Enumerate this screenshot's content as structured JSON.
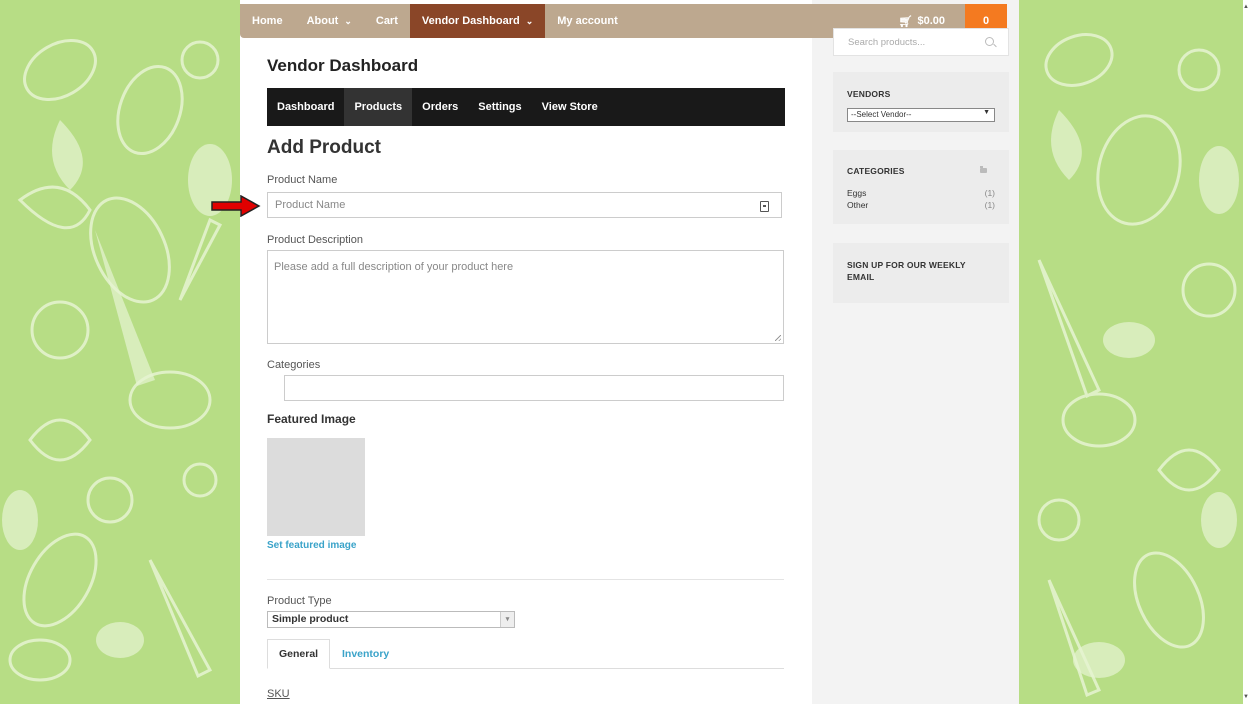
{
  "topnav": {
    "home": "Home",
    "about": "About",
    "cart": "Cart",
    "vendor_dashboard": "Vendor Dashboard",
    "my_account": "My account",
    "cart_total": "$0.00",
    "cart_count": "0"
  },
  "page_title": "Vendor Dashboard",
  "dash_menu": {
    "dashboard": "Dashboard",
    "products": "Products",
    "orders": "Orders",
    "settings": "Settings",
    "view_store": "View Store"
  },
  "form": {
    "heading": "Add Product",
    "product_name_label": "Product Name",
    "product_name_placeholder": "Product Name",
    "description_label": "Product Description",
    "description_placeholder": "Please add a full description of your product here",
    "categories_label": "Categories",
    "featured_image_title": "Featured Image",
    "set_featured_image": "Set featured image",
    "product_type_label": "Product Type",
    "product_type_value": "Simple product",
    "tab_general": "General",
    "tab_inventory": "Inventory",
    "sku_label": "SKU"
  },
  "sidebar": {
    "search_placeholder": "Search products...",
    "vendors_title": "VENDORS",
    "vendor_select_value": "--Select Vendor--",
    "categories_title": "CATEGORIES",
    "categories": [
      {
        "name": "Eggs",
        "count": "(1)"
      },
      {
        "name": "Other",
        "count": "(1)"
      }
    ],
    "signup_title": "SIGN UP FOR OUR WEEKLY EMAIL"
  },
  "colors": {
    "background_green": "#b7dd85",
    "nav_tan": "#bda88f",
    "nav_active": "#8a4628",
    "cart_orange": "#f47a20",
    "link_blue": "#3aa3c9",
    "annotation_arrow": "#e00000"
  }
}
